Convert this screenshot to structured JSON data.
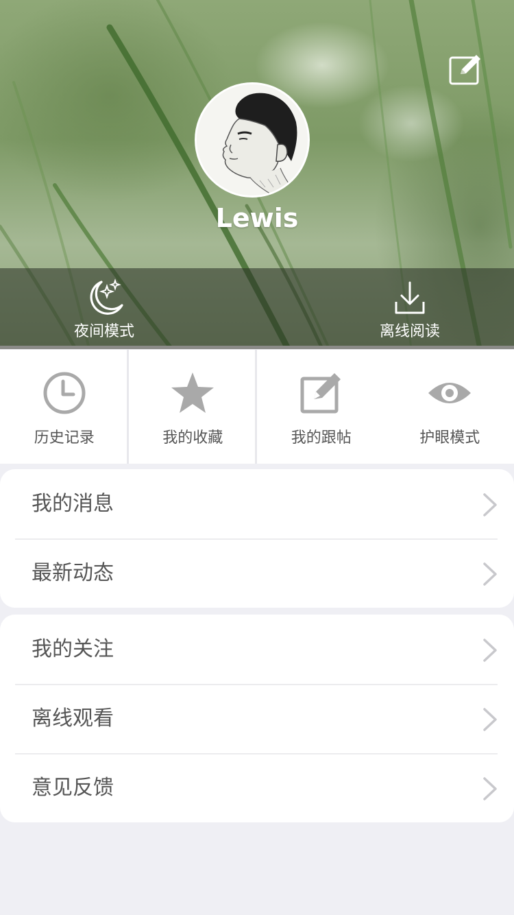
{
  "profile": {
    "username": "Lewis"
  },
  "quick_actions": [
    {
      "label": "夜间模式",
      "icon": "moon-stars-icon"
    },
    {
      "label": "离线阅读",
      "icon": "download-icon"
    }
  ],
  "grid": [
    {
      "label": "历史记录",
      "icon": "clock-icon"
    },
    {
      "label": "我的收藏",
      "icon": "star-icon"
    },
    {
      "label": "我的跟帖",
      "icon": "edit-note-icon"
    },
    {
      "label": "护眼模式",
      "icon": "eye-icon"
    }
  ],
  "menu_group_1": [
    {
      "label": "我的消息"
    },
    {
      "label": "最新动态"
    }
  ],
  "menu_group_2": [
    {
      "label": "我的关注"
    },
    {
      "label": "离线观看"
    },
    {
      "label": "意见反馈"
    }
  ],
  "colors": {
    "background": "#efeff4",
    "text": "#555555",
    "icon_gray": "#a9a9a9",
    "chevron": "#c8c8cc"
  }
}
